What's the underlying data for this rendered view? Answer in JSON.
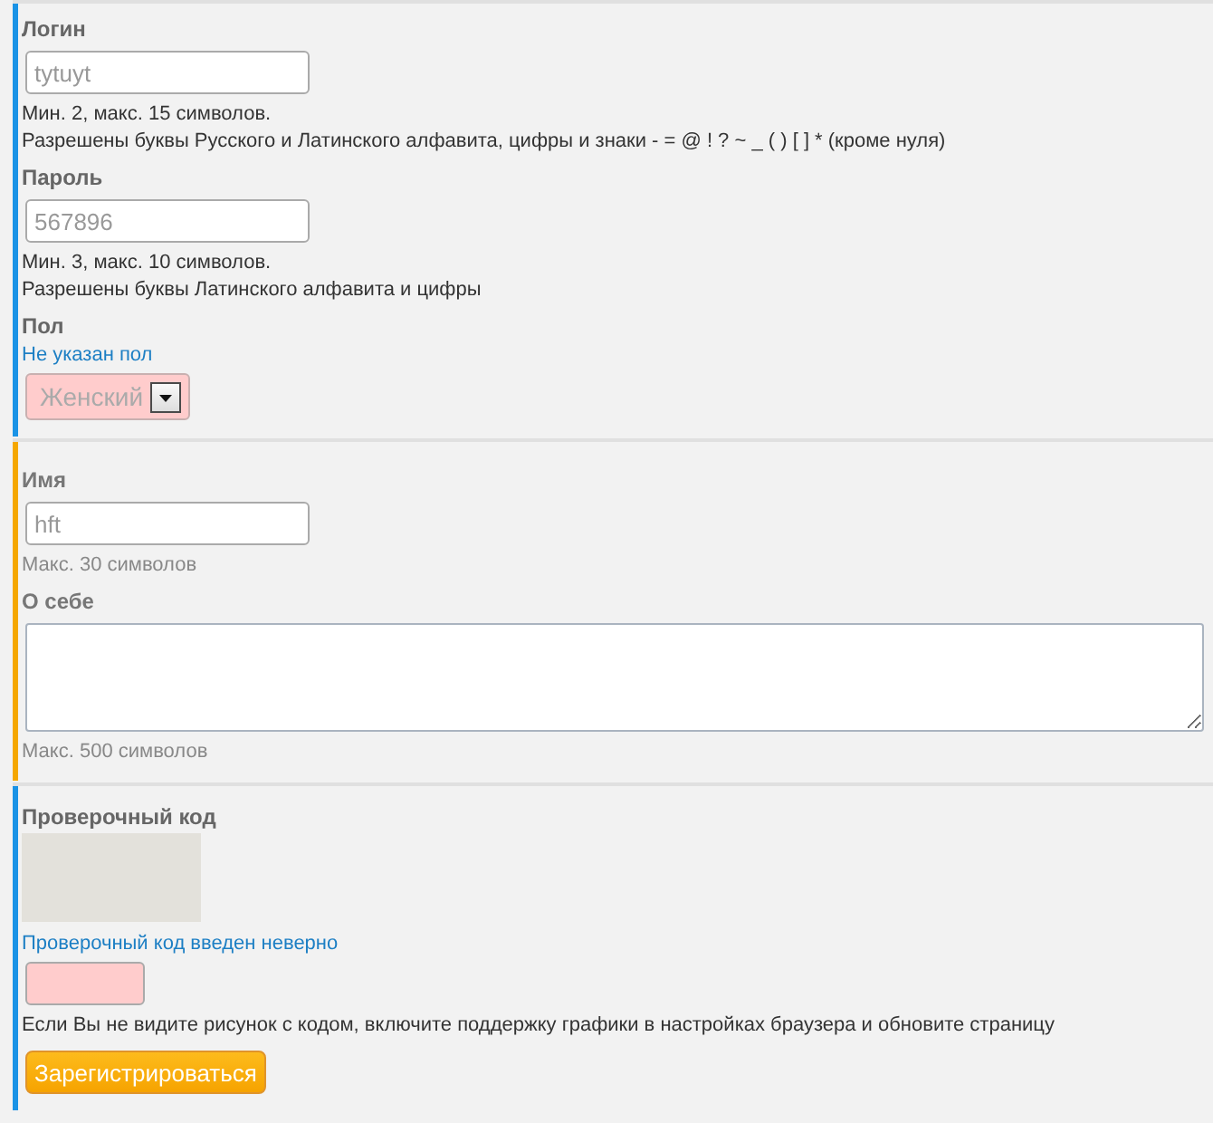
{
  "sections": [
    {
      "kind": "account",
      "color": "#1a93e6",
      "fields": [
        {
          "kind": "input",
          "label": "Логин",
          "value": "tytuyt",
          "invalid": false,
          "hints": [
            "Мин. 2, макс. 15 символов.",
            "Разрешены буквы Русского и Латинского алфавита, цифры и знаки - = @ ! ? ~ _ ( ) [ ] * (кроме нуля)"
          ]
        },
        {
          "kind": "input",
          "label": "Пароль",
          "value": "567896",
          "invalid": false,
          "hints": [
            "Мин. 3, макс. 10 символов.",
            "Разрешены буквы Латинского алфавита и цифры"
          ]
        },
        {
          "kind": "select",
          "label": "Пол",
          "error": "Не указан пол",
          "value": "Женский",
          "invalid": true
        }
      ]
    },
    {
      "kind": "profile",
      "color": "#f5a700",
      "fields": [
        {
          "kind": "input",
          "label": "Имя",
          "value": "hft",
          "invalid": false,
          "hints": [
            "Макс. 30 символов"
          ]
        },
        {
          "kind": "textarea",
          "label": "О себе",
          "invalid": false,
          "hints": [
            "Макс. 500 символов"
          ]
        }
      ]
    },
    {
      "kind": "captcha",
      "color": "#1a93e6",
      "fields": [
        {
          "kind": "captcha",
          "label": "Проверочный код",
          "error": "Проверочный код введен неверно",
          "invalid": true
        },
        {
          "kind": "note",
          "text": "Если Вы не видите рисунок с кодом, включите поддержку графики в настройках браузера и обновите страницу"
        },
        {
          "kind": "button",
          "label": "Зарегистрироваться"
        }
      ]
    }
  ]
}
